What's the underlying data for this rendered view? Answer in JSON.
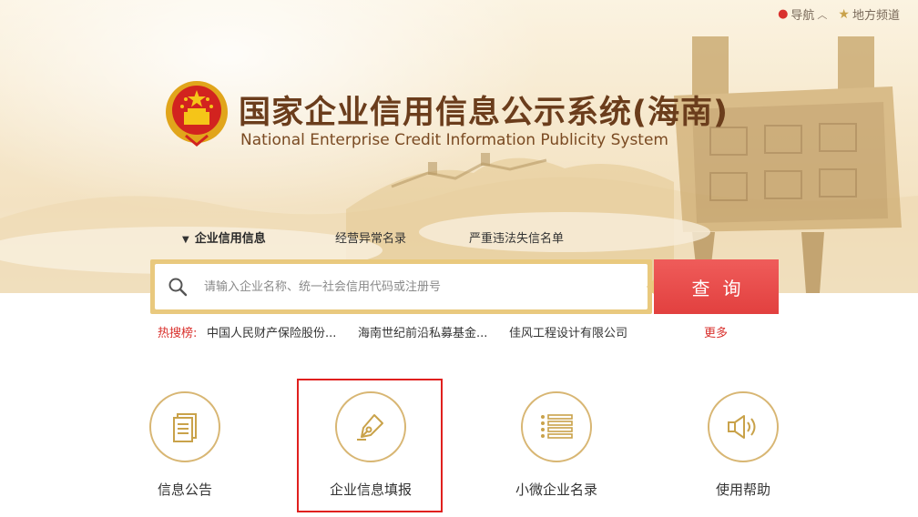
{
  "topbar": {
    "nav_label": "导航",
    "nav_caret": "︿",
    "local_label": "地方频道"
  },
  "header": {
    "title_cn": "国家企业信用信息公示系统(海南)",
    "title_en": "National Enterprise Credit Information Publicity System"
  },
  "tabs": [
    {
      "label": "企业信用信息",
      "active": true
    },
    {
      "label": "经营异常名录",
      "active": false
    },
    {
      "label": "严重违法失信名单",
      "active": false
    }
  ],
  "search": {
    "placeholder": "请输入企业名称、统一社会信用代码或注册号",
    "button_label": "查询"
  },
  "hot_search": {
    "label": "热搜榜:",
    "items": [
      "中国人民财产保险股份...",
      "海南世纪前沿私募基金...",
      "佳风工程设计有限公司"
    ],
    "more_label": "更多"
  },
  "features": [
    {
      "label": "信息公告",
      "icon": "document-icon"
    },
    {
      "label": "企业信息填报",
      "icon": "pen-nib-icon"
    },
    {
      "label": "小微企业名录",
      "icon": "list-icon"
    },
    {
      "label": "使用帮助",
      "icon": "speaker-icon"
    }
  ],
  "colors": {
    "brand_brown": "#6b3d1c",
    "gold": "#d8b673",
    "search_red": "#e2403f",
    "highlight_red": "#e0201e"
  }
}
